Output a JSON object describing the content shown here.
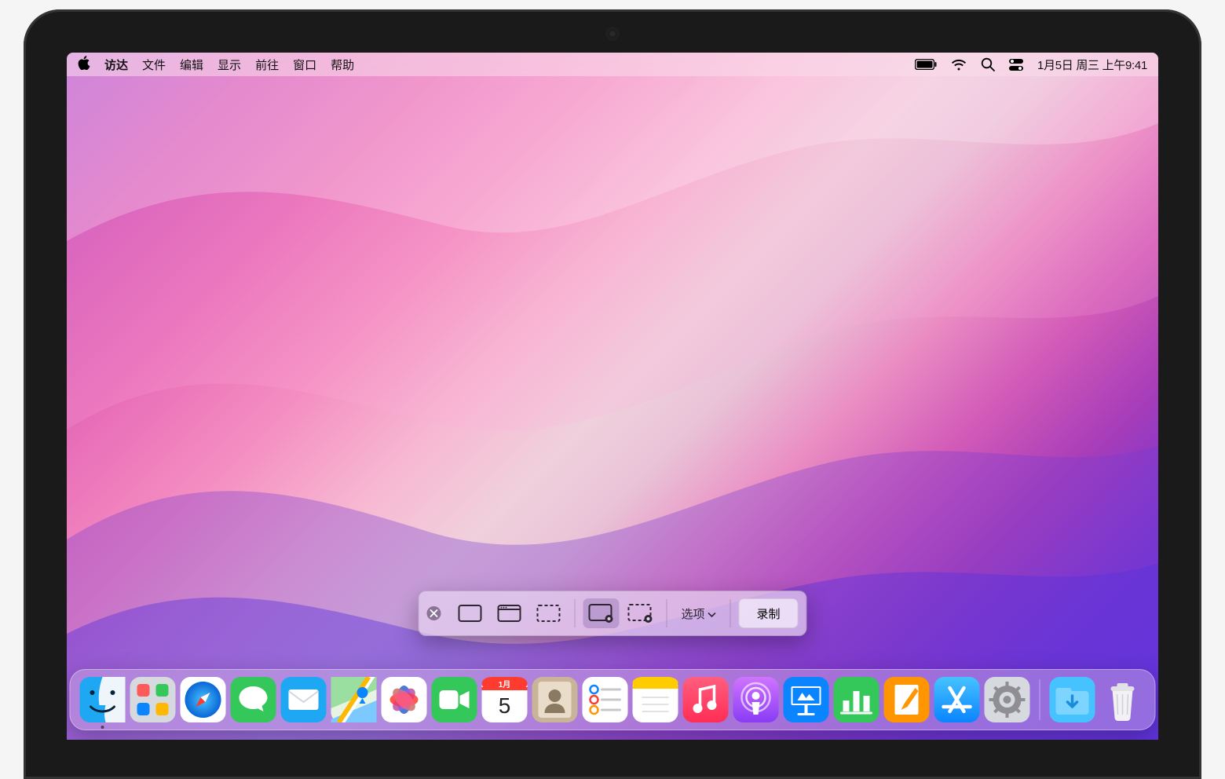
{
  "menu": {
    "app_name": "访达",
    "items": [
      "文件",
      "编辑",
      "显示",
      "前往",
      "窗口",
      "帮助"
    ]
  },
  "status": {
    "date_time": "1月5日 周三 上午9:41"
  },
  "screenshot_toolbar": {
    "options_label": "选项",
    "action_label": "录制",
    "modes": {
      "capture_entire_screen": "capture-entire-screen",
      "capture_window": "capture-window",
      "capture_selection": "capture-selection",
      "record_entire_screen": "record-entire-screen",
      "record_selection": "record-selection"
    },
    "selected_mode": "record-entire-screen"
  },
  "dock": {
    "apps": [
      {
        "name": "finder",
        "running": true
      },
      {
        "name": "launchpad"
      },
      {
        "name": "safari"
      },
      {
        "name": "messages"
      },
      {
        "name": "mail"
      },
      {
        "name": "maps"
      },
      {
        "name": "photos"
      },
      {
        "name": "facetime"
      },
      {
        "name": "calendar",
        "badge_month": "1月",
        "badge_day": "5"
      },
      {
        "name": "contacts"
      },
      {
        "name": "reminders"
      },
      {
        "name": "notes"
      },
      {
        "name": "music"
      },
      {
        "name": "podcasts"
      },
      {
        "name": "keynote"
      },
      {
        "name": "numbers"
      },
      {
        "name": "pages"
      },
      {
        "name": "appstore"
      },
      {
        "name": "settings"
      }
    ],
    "right": [
      {
        "name": "downloads"
      },
      {
        "name": "trash"
      }
    ]
  }
}
